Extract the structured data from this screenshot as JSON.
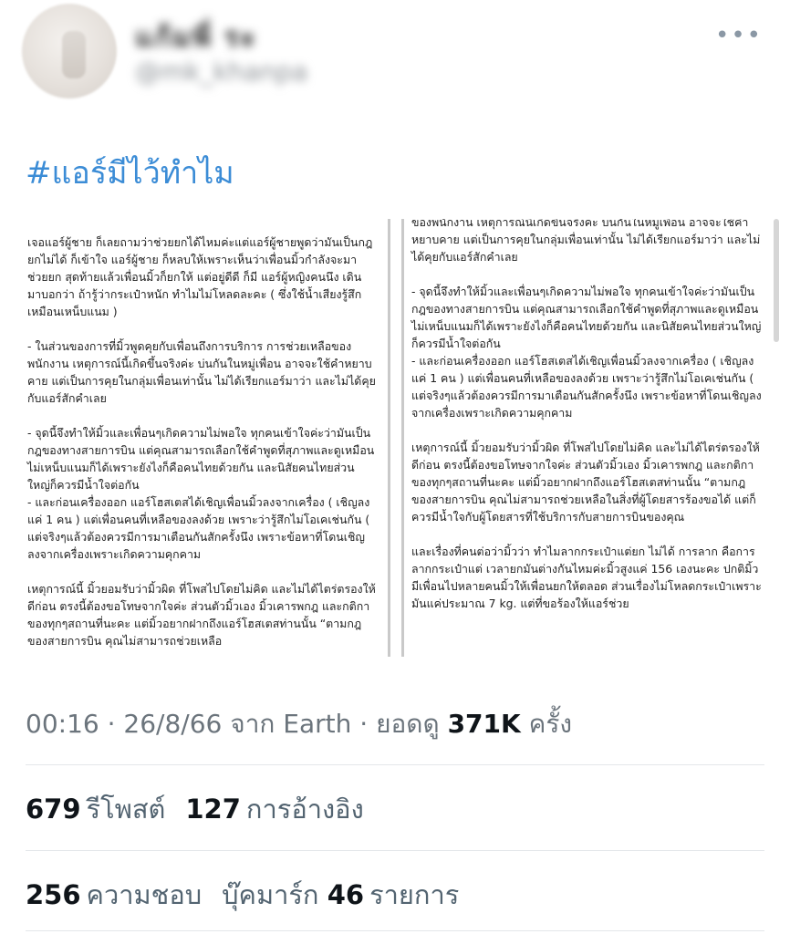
{
  "author": {
    "display_name": "แก้มพี่ ระ",
    "handle": "@mk_khanpa"
  },
  "icons": {
    "more": "more-options-icon"
  },
  "tweet": {
    "hashtag": "#แอร์มีไว้ทำไม"
  },
  "attached_image": {
    "left_column": [
      "เจอแอร์ผู้ชาย ก็เลยถามว่าช่วยยกได้ไหมค่ะแต่แอร์ผู้ชายพูดว่ามันเป็นกฎ ยกไม่ได้ ก็เข้าใจ แอร์ผู้ชาย ก็หลบให้เพราะเห็นว่าเพื่อนมิ้วกำลังจะมาช่วยยก สุดท้ายแล้วเพื่อนมิ้วก็ยกให้ แต่อยู่ดีดี ก็มี แอร์ผู้หญิงคนนึง เดินมาบอกว่า ถ้ารู้ว่ากระเป๋าหนัก ทำไมไม่โหลดละคะ ( ซึ่งใช้น้ำเสียงรู้สึกเหมือนเหน็บแนม )",
      "- ในส่วนของการที่มิ้วพูดคุยกับเพื่อนถึงการบริการ การช่วยเหลือของพนักงาน เหตุการณ์นี้เกิดขึ้นจริงค่ะ บ่นกันในหมู่เพื่อน อาจจะใช้คำหยาบคาย แต่เป็นการคุยในกลุ่มเพื่อนเท่านั้น ไม่ได้เรียกแอร์มาว่า และไม่ได้คุยกับแอร์สักคำเลย",
      "- จุดนี้จึงทำให้มิ้วและเพื่อนๆเกิดความไม่พอใจ ทุกคนเข้าใจค่ะว่ามันเป็นกฎของทางสายการบิน แต่คุณสามารถเลือกใช้คำพูดที่สุภาพและดูเหมือนไม่เหน็บแนมก็ได้เพราะยังไงก็คือคนไทยด้วยกัน และนิสัยคนไทยส่วนใหญ่ก็ควรมีน้ำใจต่อกัน\n- และก่อนเครื่องออก แอร์โฮสเตสได้เชิญเพื่อนมิ้วลงจากเครื่อง ( เชิญลงแค่ 1 คน ) แต่เพื่อนคนที่เหลือของลงด้วย เพราะว่ารู้สึกไม่โอเคเช่นกัน ( แต่จริงๆแล้วต้องควรมีการมาเตือนกันสักครั้งนึง เพราะข้อหาที่โดนเชิญลงจากเครื่องเพราะเกิดความคุกคาม",
      "เหตุการณ์นี้ มิ้วยอมรับว่ามิ้วผิด ที่โพสไปโดยไม่คิด และไม่ได้ไตร่ตรองให้ดีก่อน ตรงนี้ต้องขอโทษจากใจค่ะ ส่วนตัวมิ้วเอง มิ้วเคารพกฎ และกติกาของทุกๆสถานที่นะคะ แต่มิ้วอยากฝากถึงแอร์โฮสเตสท่านนั้น “ตามกฎของสายการบิน คุณไม่สามารถช่วยเหลือ"
    ],
    "right_column": [
      "ของพนักงาน เหตุการณ์นี้เกิดขึ้นจริงค่ะ บ่นกันในหมู่เพื่อน อาจจะใช้คำหยาบคาย แต่เป็นการคุยในกลุ่มเพื่อนเท่านั้น ไม่ได้เรียกแอร์มาว่า และไม่ได้คุยกับแอร์สักคำเลย",
      "- จุดนี้จึงทำให้มิ้วและเพื่อนๆเกิดความไม่พอใจ ทุกคนเข้าใจค่ะว่ามันเป็นกฎของทางสายการบิน แต่คุณสามารถเลือกใช้คำพูดที่สุภาพและดูเหมือนไม่เหน็บแนมก็ได้เพราะยังไงก็คือคนไทยด้วยกัน และนิสัยคนไทยส่วนใหญ่ก็ควรมีน้ำใจต่อกัน\n- และก่อนเครื่องออก แอร์โฮสเตสได้เชิญเพื่อนมิ้วลงจากเครื่อง ( เชิญลงแค่ 1 คน ) แต่เพื่อนคนที่เหลือของลงด้วย เพราะว่ารู้สึกไม่โอเคเช่นกัน ( แต่จริงๆแล้วต้องควรมีการมาเตือนกันสักครั้งนึง เพราะข้อหาที่โดนเชิญลงจากเครื่องเพราะเกิดความคุกคาม",
      "เหตุการณ์นี้ มิ้วยอมรับว่ามิ้วผิด ที่โพสไปโดยไม่คิด และไม่ได้ไตร่ตรองให้ดีก่อน ตรงนี้ต้องขอโทษจากใจค่ะ ส่วนตัวมิ้วเอง มิ้วเคารพกฎ และกติกาของทุกๆสถานที่นะคะ แต่มิ้วอยากฝากถึงแอร์โฮสเตสท่านนั้น “ตามกฎของสายการบิน คุณไม่สามารถช่วยเหลือในสิ่งที่ผู้โดยสารร้องขอได้ แต่ก็ควรมีน้ำใจกับผู้โดยสารที่ใช้บริการกับสายการบินของคุณ",
      "และเรื่องที่คนต่อว่ามิ้วว่า ทำไมลากกระเป๋าแต่ยก ไม่ได้ การลาก คือการลากกระเป๋าแต่ เวลายกมันต่างกันไหมค่ะมิ้วสูงแค่ 156 เองนะคะ ปกติมิ้วมีเพื่อนไปหลายคนมิ้วให้เพื่อนยกให้ตลอด ส่วนเรื่องไม่โหลดกระเป๋าเพราะ มันแค่ประมาณ 7 kg. แต่ที่ขอร้องให้แอร์ช่วย"
    ]
  },
  "meta": {
    "time": "00:16",
    "date": "26/8/66",
    "source": "จาก Earth",
    "views_label": "ยอดดู",
    "views_count": "371K",
    "views_suffix": "ครั้ง"
  },
  "stats": {
    "reposts_count": "679",
    "reposts_label": "รีโพสต์",
    "quotes_count": "127",
    "quotes_label": "การอ้างอิง",
    "likes_count": "256",
    "likes_label": "ความชอบ",
    "bookmarks_prefix": "บุ๊คมาร์ก",
    "bookmarks_count": "46",
    "bookmarks_suffix": "รายการ"
  }
}
